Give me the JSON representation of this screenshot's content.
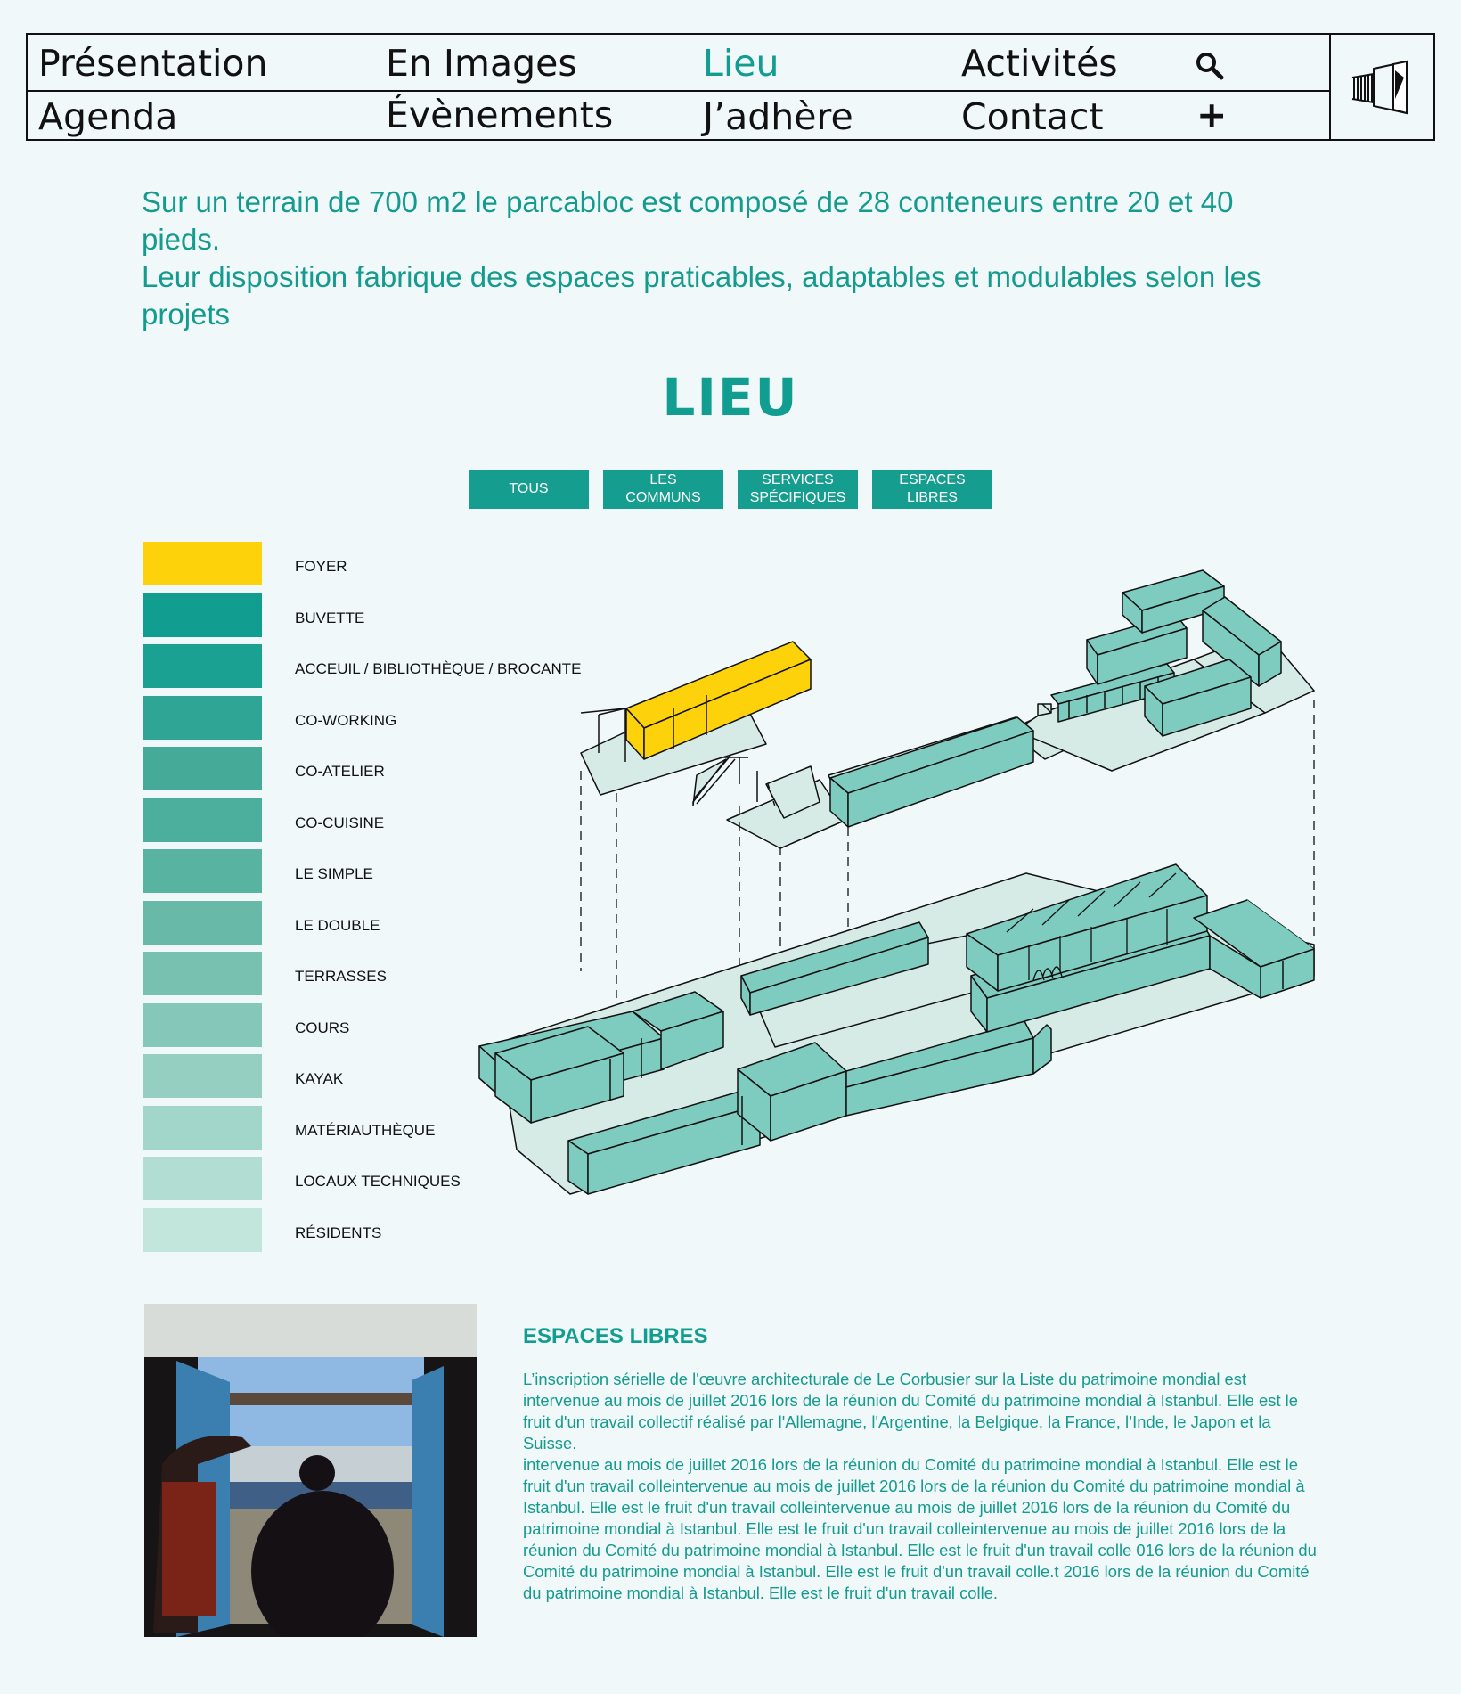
{
  "nav": {
    "row1": [
      "Présentation",
      "En Images",
      "Lieu",
      "Activités"
    ],
    "row2": [
      "Agenda",
      "Évènements",
      "J’adhère",
      "Contact"
    ],
    "active": "Lieu",
    "search_icon": "search-icon",
    "plus_label": "+",
    "logo_icon": "container-logo-icon"
  },
  "intro": {
    "line1": "Sur un terrain de 700 m2 le parcabloc est composé de 28 conteneurs entre 20 et 40 pieds.",
    "line2": "Leur disposition fabrique des espaces praticables, adaptables et modulables selon les projets"
  },
  "section_title": "LIEU",
  "filters": [
    {
      "label": "TOUS"
    },
    {
      "label": "LES\nCOMMUNS"
    },
    {
      "label": "SERVICES\nSPÉCIFIQUES"
    },
    {
      "label": "ESPACES\nLIBRES"
    }
  ],
  "legend": [
    {
      "label": "FOYER",
      "color": "#fed20a"
    },
    {
      "label": "BUVETTE",
      "color": "#119d8f"
    },
    {
      "label": "ACCEUIL / BIBLIOTHÈQUE / BROCANTE",
      "color": "#1ba191"
    },
    {
      "label": "CO-WORKING",
      "color": "#2ea595"
    },
    {
      "label": "CO-ATELIER",
      "color": "#45ab98"
    },
    {
      "label": "CO-CUISINE",
      "color": "#4caf9d"
    },
    {
      "label": "LE SIMPLE",
      "color": "#58b3a1"
    },
    {
      "label": "LE DOUBLE",
      "color": "#68b9a8"
    },
    {
      "label": "TERRASSES",
      "color": "#78c1b1"
    },
    {
      "label": "COURS",
      "color": "#85c7b8"
    },
    {
      "label": "KAYAK",
      "color": "#94cfc1"
    },
    {
      "label": "MATÉRIAUTHÈQUE",
      "color": "#a3d6ca"
    },
    {
      "label": "LOCAUX TECHNIQUES",
      "color": "#b1ddd3"
    },
    {
      "label": "RÉSIDENTS",
      "color": "#c2e5dc"
    }
  ],
  "espaces": {
    "title": "ESPACES LIBRES",
    "p1": "L’inscription sérielle de l'œuvre architecturale de Le Corbusier sur la Liste du patrimoine mondial est intervenue au mois de juillet 2016 lors de la réunion du Comité du patrimoine mondial à Istanbul. Elle est le fruit d'un travail collectif réalisé par l'Allemagne, l'Argentine, la Belgique, la France, l’Inde, le Japon et la Suisse.",
    "p2": "intervenue au mois de juillet 2016 lors de la réunion du Comité du patrimoine mondial à Istanbul. Elle est le fruit d'un travail colleintervenue au mois de juillet 2016 lors de la réunion du Comité du patrimoine mondial à Istanbul. Elle est le fruit d'un travail colleintervenue au mois de juillet 2016 lors de la réunion du Comité du patrimoine mondial à Istanbul. Elle est le fruit d'un travail colleintervenue au mois de juillet 2016 lors de la réunion du Comité du patrimoine mondial à Istanbul. Elle est le fruit d'un travail colle 016 lors de la réunion du Comité du patrimoine mondial à Istanbul. Elle est le fruit d'un travail colle.t 2016 lors de la réunion du Comité du patrimoine mondial à Istanbul. Elle est le fruit d'un travail colle."
  },
  "colors": {
    "accent": "#119d8f",
    "container": "#7ecbbf",
    "ground": "#d6ebe6",
    "foyer": "#fed20a",
    "background": "#f0f8fa"
  }
}
